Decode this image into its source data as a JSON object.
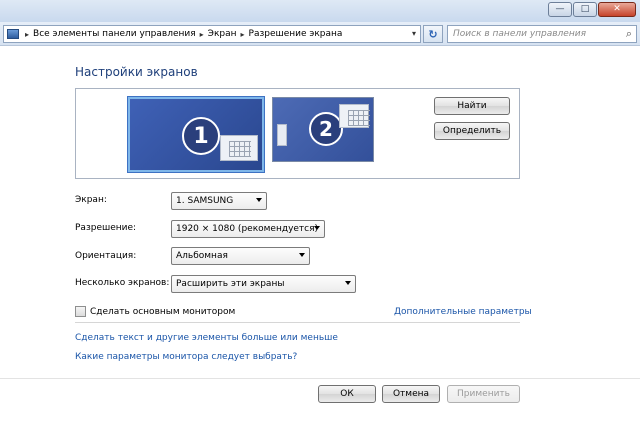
{
  "titlebar": {
    "minimize_glyph": "—",
    "maximize_glyph": "□",
    "close_glyph": "✕"
  },
  "address": {
    "crumbs": [
      "Все элементы панели управления",
      "Экран",
      "Разрешение экрана"
    ],
    "separator": "▸",
    "dropdown_glyph": "▾",
    "refresh_glyph": "↻"
  },
  "search": {
    "placeholder": "Поиск в панели управления",
    "icon_glyph": "⌕"
  },
  "page": {
    "title": "Настройки экранов"
  },
  "monitors": [
    {
      "number": "1"
    },
    {
      "number": "2"
    }
  ],
  "buttons": {
    "find": "Найти",
    "identify": "Определить",
    "ok": "ОК",
    "cancel": "Отмена",
    "apply": "Применить"
  },
  "settings": {
    "screen": {
      "label": "Экран:",
      "value": "1. SAMSUNG"
    },
    "resolution": {
      "label": "Разрешение:",
      "value": "1920 × 1080 (рекомендуется)"
    },
    "orientation": {
      "label": "Ориентация:",
      "value": "Альбомная"
    },
    "multiple": {
      "label": "Несколько экранов:",
      "value": "Расширить эти экраны"
    }
  },
  "primary_checkbox": {
    "label": "Сделать основным монитором",
    "checked": false
  },
  "links": {
    "advanced": "Дополнительные параметры",
    "text_size": "Сделать текст и другие элементы больше или меньше",
    "which_settings": "Какие параметры монитора следует выбрать?"
  },
  "colors": {
    "link": "#1a55a8",
    "title": "#1e3f7a",
    "monitor_fill": "#3f61b6",
    "selected_border": "#7fb7ea"
  }
}
